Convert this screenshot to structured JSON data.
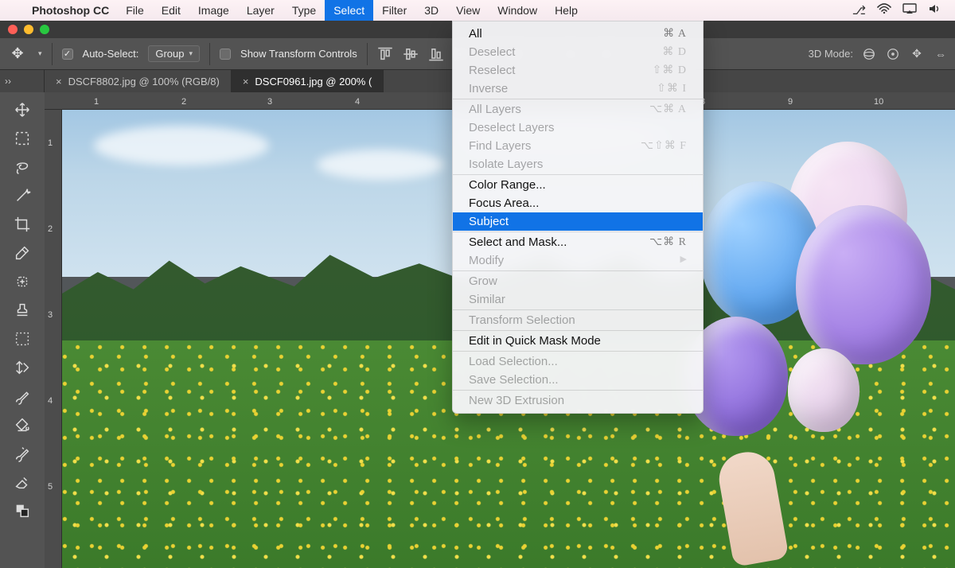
{
  "menubar": {
    "app": "Photoshop CC",
    "items": [
      "File",
      "Edit",
      "Image",
      "Layer",
      "Type",
      "Select",
      "Filter",
      "3D",
      "View",
      "Window",
      "Help"
    ],
    "active": "Select"
  },
  "dropdown": {
    "groups": [
      [
        {
          "label": "All",
          "shortcut": "⌘ A",
          "enabled": true
        },
        {
          "label": "Deselect",
          "shortcut": "⌘ D",
          "enabled": false
        },
        {
          "label": "Reselect",
          "shortcut": "⇧⌘ D",
          "enabled": false
        },
        {
          "label": "Inverse",
          "shortcut": "⇧⌘ I",
          "enabled": false
        }
      ],
      [
        {
          "label": "All Layers",
          "shortcut": "⌥⌘ A",
          "enabled": false
        },
        {
          "label": "Deselect Layers",
          "shortcut": "",
          "enabled": false
        },
        {
          "label": "Find Layers",
          "shortcut": "⌥⇧⌘ F",
          "enabled": false
        },
        {
          "label": "Isolate Layers",
          "shortcut": "",
          "enabled": false
        }
      ],
      [
        {
          "label": "Color Range...",
          "shortcut": "",
          "enabled": true
        },
        {
          "label": "Focus Area...",
          "shortcut": "",
          "enabled": true
        },
        {
          "label": "Subject",
          "shortcut": "",
          "enabled": true,
          "highlight": true
        }
      ],
      [
        {
          "label": "Select and Mask...",
          "shortcut": "⌥⌘ R",
          "enabled": true
        },
        {
          "label": "Modify",
          "shortcut": "",
          "enabled": false,
          "submenu": true
        }
      ],
      [
        {
          "label": "Grow",
          "shortcut": "",
          "enabled": false
        },
        {
          "label": "Similar",
          "shortcut": "",
          "enabled": false
        }
      ],
      [
        {
          "label": "Transform Selection",
          "shortcut": "",
          "enabled": false
        }
      ],
      [
        {
          "label": "Edit in Quick Mask Mode",
          "shortcut": "",
          "enabled": true
        }
      ],
      [
        {
          "label": "Load Selection...",
          "shortcut": "",
          "enabled": false
        },
        {
          "label": "Save Selection...",
          "shortcut": "",
          "enabled": false
        }
      ],
      [
        {
          "label": "New 3D Extrusion",
          "shortcut": "",
          "enabled": false
        }
      ]
    ]
  },
  "options": {
    "auto_select_label": "Auto-Select:",
    "auto_select_checked": true,
    "auto_select_value": "Group",
    "show_transform_label": "Show Transform Controls",
    "show_transform_checked": false,
    "mode3d_label": "3D Mode:"
  },
  "tabs": [
    {
      "label": "DSCF8802.jpg @ 100% (RGB/8)",
      "active": false
    },
    {
      "label": "DSCF0961.jpg @ 200% (",
      "active": true
    }
  ],
  "ruler_h": [
    1,
    2,
    3,
    4,
    8,
    9,
    10
  ],
  "ruler_v": [
    1,
    2,
    3,
    4,
    5
  ],
  "tools": [
    "move",
    "marquee",
    "lasso",
    "magic-wand",
    "crop",
    "eyedropper",
    "heal",
    "stamp",
    "marquee-dashed",
    "free-transform",
    "brush",
    "fill-bucket",
    "history-brush",
    "eraser",
    "foreground-bg"
  ]
}
